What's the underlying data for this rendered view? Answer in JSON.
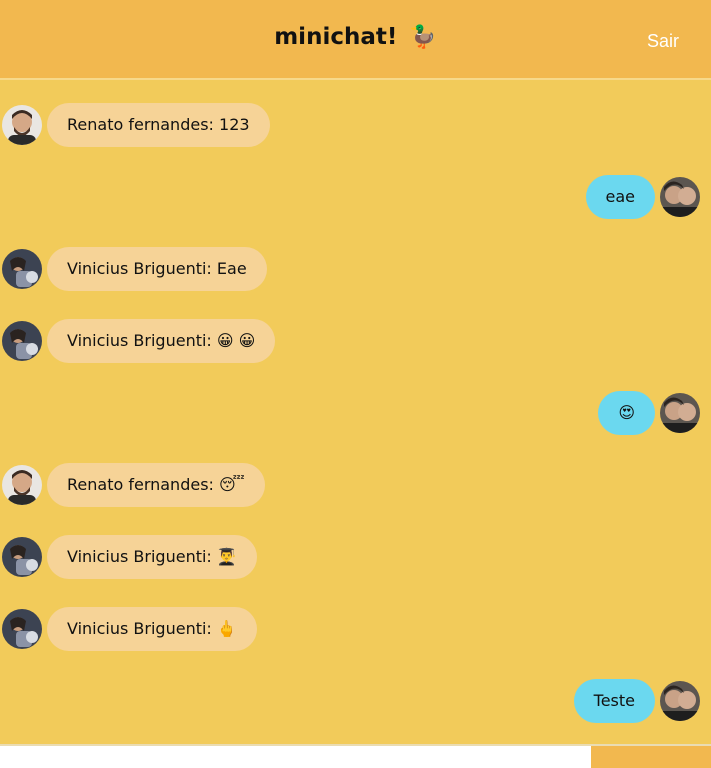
{
  "header": {
    "title": "minichat!",
    "logo_emoji": "🦆",
    "logout_label": "Sair"
  },
  "messages": [
    {
      "direction": "in",
      "avatar": "renato",
      "text": "Renato fernandes: 123"
    },
    {
      "direction": "out",
      "avatar": "self",
      "text": "eae"
    },
    {
      "direction": "in",
      "avatar": "vinicius",
      "text": "Vinicius Briguenti: Eae"
    },
    {
      "direction": "in",
      "avatar": "vinicius",
      "text": "Vinicius Briguenti: 😀 😀"
    },
    {
      "direction": "out",
      "avatar": "self",
      "text": "😍"
    },
    {
      "direction": "in",
      "avatar": "renato",
      "text": "Renato fernandes: 😴"
    },
    {
      "direction": "in",
      "avatar": "vinicius",
      "text": "Vinicius Briguenti: 👨‍🎓"
    },
    {
      "direction": "in",
      "avatar": "vinicius",
      "text": "Vinicius Briguenti: 🖕"
    },
    {
      "direction": "out",
      "avatar": "self",
      "text": "Teste"
    }
  ],
  "composer": {
    "input_value": "",
    "input_placeholder": "",
    "send_label": ""
  },
  "colors": {
    "background": "#f2cb5a",
    "header": "#f2b84f",
    "incoming_bubble": "#f6d397",
    "outgoing_bubble": "#6bd8ef"
  }
}
